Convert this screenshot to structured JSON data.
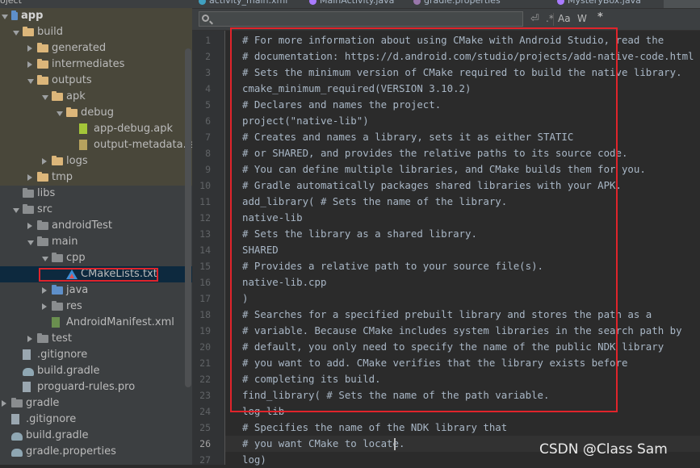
{
  "tree": {
    "header": "oject",
    "items": [
      {
        "label": "app",
        "level": 0,
        "arrow": "open",
        "icon": "module-icon",
        "bold": true,
        "tint": true
      },
      {
        "label": "build",
        "level": 1,
        "arrow": "open",
        "icon": "folder-icon",
        "tint": true
      },
      {
        "label": "generated",
        "level": 2,
        "arrow": "closed",
        "icon": "folder-icon",
        "tint": true
      },
      {
        "label": "intermediates",
        "level": 2,
        "arrow": "closed",
        "icon": "folder-icon",
        "tint": true
      },
      {
        "label": "outputs",
        "level": 2,
        "arrow": "open",
        "icon": "folder-icon",
        "tint": true
      },
      {
        "label": "apk",
        "level": 3,
        "arrow": "open",
        "icon": "folder-icon",
        "tint": true
      },
      {
        "label": "debug",
        "level": 4,
        "arrow": "open",
        "icon": "folder-icon",
        "tint": true
      },
      {
        "label": "app-debug.apk",
        "level": 5,
        "arrow": "none",
        "icon": "apk-file-icon",
        "tint": true
      },
      {
        "label": "output-metadata.json",
        "level": 5,
        "arrow": "none",
        "icon": "json-file-icon",
        "tint": true
      },
      {
        "label": "logs",
        "level": 3,
        "arrow": "closed",
        "icon": "folder-icon",
        "tint": true
      },
      {
        "label": "tmp",
        "level": 2,
        "arrow": "closed",
        "icon": "folder-icon",
        "tint": true
      },
      {
        "label": "libs",
        "level": 1,
        "arrow": "none",
        "icon": "folder-grey-icon",
        "tint": false
      },
      {
        "label": "src",
        "level": 1,
        "arrow": "open",
        "icon": "folder-grey-icon",
        "tint": false
      },
      {
        "label": "androidTest",
        "level": 2,
        "arrow": "closed",
        "icon": "folder-grey-icon",
        "tint": false
      },
      {
        "label": "main",
        "level": 2,
        "arrow": "open",
        "icon": "folder-grey-icon",
        "tint": false
      },
      {
        "label": "cpp",
        "level": 3,
        "arrow": "open",
        "icon": "folder-grey-icon",
        "tint": false
      },
      {
        "label": "CMakeLists.txt",
        "level": 4,
        "arrow": "none",
        "icon": "cmake-icon",
        "tint": false,
        "selected": true
      },
      {
        "label": "java",
        "level": 3,
        "arrow": "closed",
        "icon": "folder-blue-icon",
        "tint": false
      },
      {
        "label": "res",
        "level": 3,
        "arrow": "closed",
        "icon": "res-folder-icon",
        "tint": false
      },
      {
        "label": "AndroidManifest.xml",
        "level": 3,
        "arrow": "none",
        "icon": "xml-file-icon",
        "tint": false
      },
      {
        "label": "test",
        "level": 2,
        "arrow": "closed",
        "icon": "folder-grey-icon",
        "tint": false
      },
      {
        "label": ".gitignore",
        "level": 1,
        "arrow": "none",
        "icon": "gitignore-file-icon",
        "tint": false
      },
      {
        "label": "build.gradle",
        "level": 1,
        "arrow": "none",
        "icon": "gradle-icon",
        "tint": false
      },
      {
        "label": "proguard-rules.pro",
        "level": 1,
        "arrow": "none",
        "icon": "pro-file-icon",
        "tint": false
      },
      {
        "label": "gradle",
        "level": 0,
        "arrow": "closed",
        "icon": "folder-grey-icon",
        "tint": false
      },
      {
        "label": ".gitignore",
        "level": 0,
        "arrow": "none",
        "icon": "gitignore-file-icon",
        "tint": false
      },
      {
        "label": "build.gradle",
        "level": 0,
        "arrow": "none",
        "icon": "gradle-icon",
        "tint": false
      },
      {
        "label": "gradle.properties",
        "level": 0,
        "arrow": "none",
        "icon": "gradle-icon",
        "tint": false
      }
    ]
  },
  "tabs": [
    {
      "label": "activity_main.xml",
      "icon": "xml-tab-icon"
    },
    {
      "label": "MainActivity.java",
      "icon": "class-tab-icon"
    },
    {
      "label": "gradle.properties",
      "icon": "gradle-tab-icon"
    },
    {
      "label": "MysteryBox.java",
      "icon": "class-tab-icon"
    }
  ],
  "search": {
    "case_label": "Aa",
    "word_label": "W",
    "regex_label": ".*",
    "star_label": "*"
  },
  "editor": {
    "current_line": 26,
    "lines": [
      "# For more information about using CMake with Android Studio, read the",
      "# documentation: https://d.android.com/studio/projects/add-native-code.html",
      "# Sets the minimum version of CMake required to build the native library.",
      "cmake_minimum_required(VERSION 3.10.2)",
      "# Declares and names the project.",
      "project(\"native-lib\")",
      "# Creates and names a library, sets it as either STATIC",
      "# or SHARED, and provides the relative paths to its source code.",
      "# You can define multiple libraries, and CMake builds them for you.",
      "# Gradle automatically packages shared libraries with your APK.",
      "add_library( # Sets the name of the library.",
      "native-lib",
      "# Sets the library as a shared library.",
      "SHARED",
      "# Provides a relative path to your source file(s).",
      "native-lib.cpp",
      ")",
      "# Searches for a specified prebuilt library and stores the path as a",
      "# variable. Because CMake includes system libraries in the search path by",
      "# default, you only need to specify the name of the public NDK library",
      "# you want to add. CMake verifies that the library exists before",
      "# completing its build.",
      "find_library( # Sets the name of the path variable.",
      "log-lib",
      "# Specifies the name of the NDK library that",
      "# you want CMake to locate.",
      "log)"
    ]
  },
  "watermark": "CSDN @Class Sam",
  "colors": {
    "highlight_box": "#e0242b",
    "editor_bg": "#2b2b2b",
    "panel_bg": "#3c3f41"
  }
}
